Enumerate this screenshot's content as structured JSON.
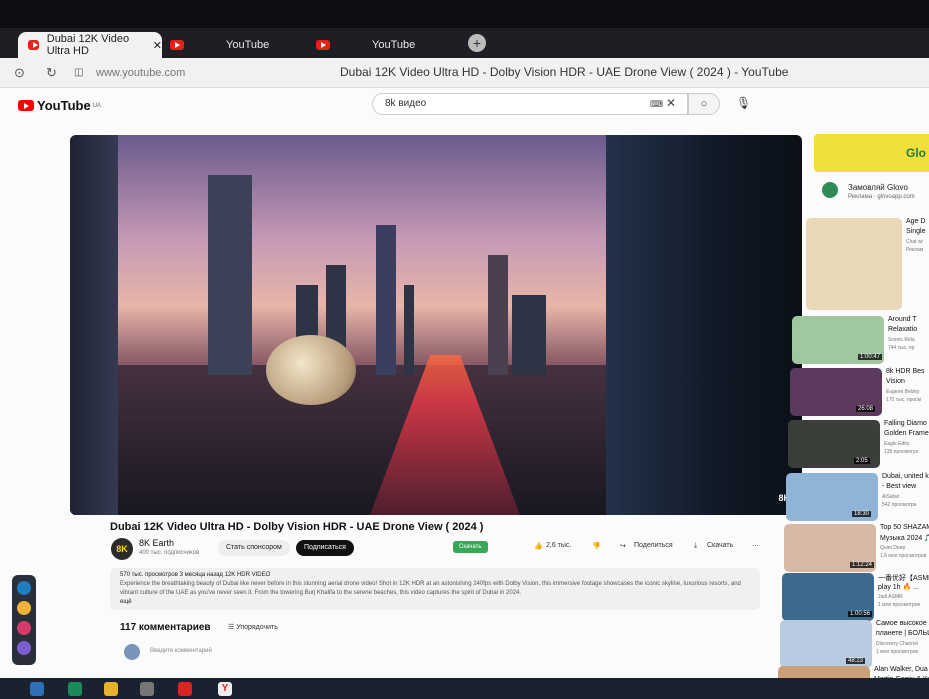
{
  "browser": {
    "tabs": [
      {
        "label": "Dubai 12K Video Ultra HD",
        "active": true
      },
      {
        "label": "YouTube",
        "active": false
      },
      {
        "label": "YouTube",
        "active": false
      }
    ],
    "new_tab_icon": "plus-icon",
    "url": "www.youtube.com",
    "page_title": "Dubai 12K Video Ultra HD - Dolby Vision HDR - UAE Drone View ( 2024 ) - YouTube"
  },
  "header": {
    "logo_text": "YouTube",
    "logo_region": "UA",
    "search_query": "8k видео"
  },
  "video": {
    "title": "Dubai 12K Video Ultra HD - Dolby Vision HDR - UAE Drone View ( 2024 )",
    "badge": "8K"
  },
  "channel": {
    "avatar_text": "8K",
    "name": "8K Earth",
    "subscribers": "400 тыс. подписчиков",
    "sponsor_label": "Стать спонсором",
    "subscribe_label": "Подписаться"
  },
  "actions": {
    "download_label": "Скачать",
    "likes": "2,6 тыс.",
    "share_label": "Поделиться",
    "download2_label": "Скачать"
  },
  "description": {
    "meta": "570 тыс. просмотров  3 месяца назад  12K HDR VIDEO",
    "text": "Experience the breathtaking beauty of Dubai like never before in this stunning aerial drone video! Shot in 12K HDR at an astonishing 240fps with Dolby Vision, this immersive footage showcases the iconic skyline, luxurious resorts, and vibrant culture of the UAE as you've never seen it. From the towering Burj Khalifa to the serene beaches, this video captures the spirit of Dubai in 2024.",
    "more": "ещё"
  },
  "comments": {
    "count_label": "117 комментариев",
    "sort_label": "Упорядочить",
    "input_placeholder": "Введите комментарий"
  },
  "sidebar": {
    "ad": {
      "banner_text": "Glo",
      "title": "Замовляй Glovo",
      "site": "Реклама · glovoapp.com"
    },
    "items": [
      {
        "t1": "Age D",
        "t2": "Single",
        "t3": "Chat wi",
        "t4": "Реклам",
        "dur": "",
        "thumb": "#e9d9b8"
      },
      {
        "t1": "Around T",
        "t2": "Relaxatio",
        "t3": "Scenic Rela",
        "t4": "744 тыс. пр",
        "dur": "1:00:47",
        "thumb": "#9fc7a0"
      },
      {
        "t1": "8k HDR Bes",
        "t2": "Vision",
        "t3": "Eugene Belsky",
        "t4": "170 тыс. просм",
        "dur": "26:08",
        "thumb": "#5b3a5e"
      },
      {
        "t1": "Falling Diamo",
        "t2": "Golden Frame",
        "t3": "Eagle Edits",
        "t4": "135 просмотро",
        "dur": "2:05",
        "thumb": "#3b3f3a"
      },
      {
        "t1": "Dubai, united k",
        "t2": "- Best view",
        "t3": "AiSafari",
        "t4": "542 просмотра",
        "dur": "18:30",
        "thumb": "#8fb4d8"
      },
      {
        "t1": "Top 50 SHAZAM",
        "t2": "Музыка 2024 🎵",
        "t3": "Quiet Deep",
        "t4": "1,6 млн просмотров",
        "dur": "1:12:24",
        "thumb": "#d8b7a4"
      },
      {
        "t1": "一番优好【ASMR】",
        "t2": "play 1h 🔥 ...",
        "t3": "Jadi ASMR",
        "t4": "1 млн просмотров",
        "dur": "1:00:56",
        "thumb": "#3b6a8e"
      },
      {
        "t1": "Самое высокое здан",
        "t2": "планете | БОЛЬШОЕ",
        "t3": "Discovery Channel",
        "t4": "1 млн просмотров",
        "dur": "48:23",
        "thumb": "#b9cbe0"
      },
      {
        "t1": "Alan Walker, Dua Lipa,",
        "t2": "Martin Garrix & Kygo, The",
        "t3": "",
        "t4": "",
        "dur": "",
        "thumb": "#c9a07a"
      }
    ]
  }
}
